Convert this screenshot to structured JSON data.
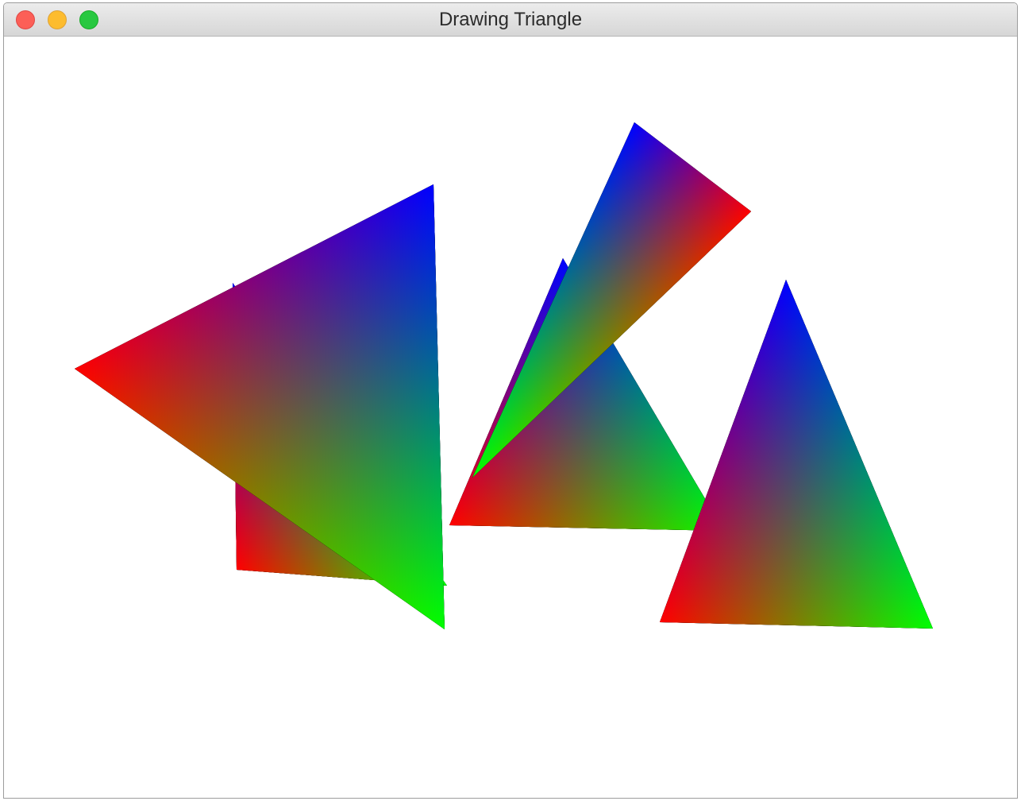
{
  "window": {
    "title": "Drawing Triangle",
    "controls": [
      "close",
      "minimize",
      "zoom"
    ]
  },
  "triangles": [
    {
      "id": "tri-back-left",
      "red": [
        298,
        717
      ],
      "green": [
        563,
        737
      ],
      "blue": [
        293,
        356
      ]
    },
    {
      "id": "tri-back-center",
      "red": [
        566,
        661
      ],
      "green": [
        912,
        668
      ],
      "blue": [
        709,
        325
      ]
    },
    {
      "id": "tri-front-left",
      "red": [
        94,
        464
      ],
      "green": [
        560,
        792
      ],
      "blue": [
        546,
        232
      ]
    },
    {
      "id": "tri-front-top",
      "red": [
        946,
        266
      ],
      "green": [
        595,
        601
      ],
      "blue": [
        799,
        154
      ]
    },
    {
      "id": "tri-right",
      "red": [
        831,
        783
      ],
      "green": [
        1175,
        791
      ],
      "blue": [
        990,
        352
      ]
    }
  ],
  "vertex_colors": {
    "red": "#ff0000",
    "green": "#00ff00",
    "blue": "#0000ff"
  }
}
